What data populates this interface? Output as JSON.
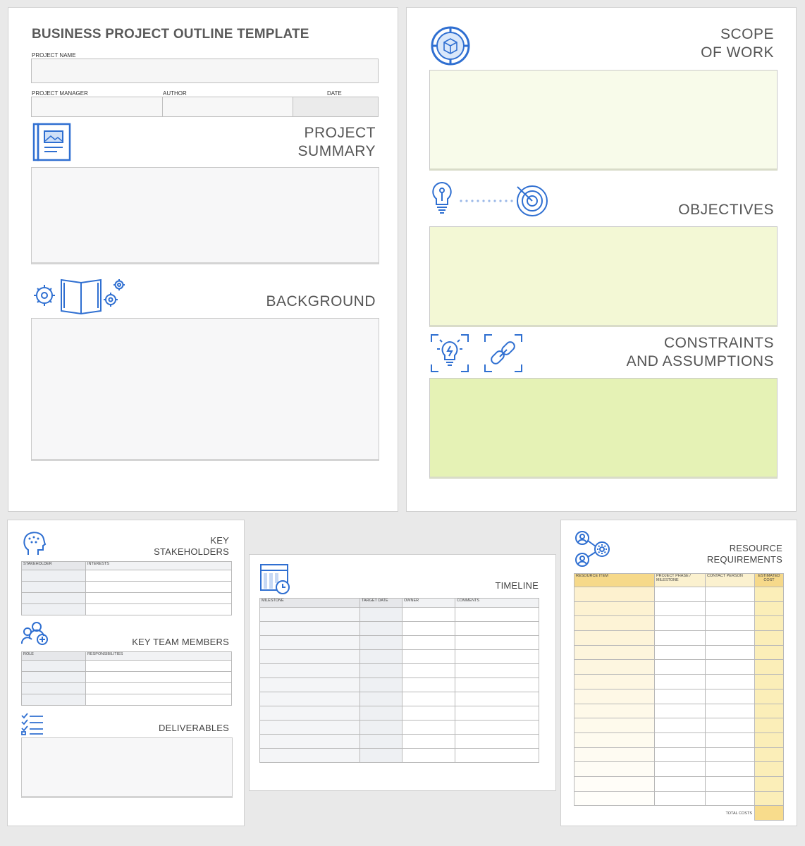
{
  "page1": {
    "title": "BUSINESS PROJECT OUTLINE TEMPLATE",
    "project_name_label": "PROJECT NAME",
    "project_manager_label": "PROJECT MANAGER",
    "author_label": "AUTHOR",
    "date_label": "DATE",
    "project_summary": [
      "PROJECT",
      "SUMMARY"
    ],
    "background": "BACKGROUND"
  },
  "page2": {
    "scope_of_work": [
      "SCOPE",
      "OF WORK"
    ],
    "objectives": "OBJECTIVES",
    "constraints": [
      "CONSTRAINTS",
      "AND ASSUMPTIONS"
    ]
  },
  "page3": {
    "key_stakeholders": [
      "KEY",
      "STAKEHOLDERS"
    ],
    "stakeholders_cols": [
      "STAKEHOLDER",
      "INTERESTS"
    ],
    "key_team_members": "KEY TEAM MEMBERS",
    "team_cols": [
      "ROLE",
      "RESPONSIBILITIES"
    ],
    "deliverables": "DELIVERABLES"
  },
  "page4": {
    "timeline": "TIMELINE",
    "timeline_cols": [
      "MILESTONE",
      "TARGET DATE",
      "OWNER",
      "COMMENTS"
    ]
  },
  "page5": {
    "resource_requirements": [
      "RESOURCE",
      "REQUIREMENTS"
    ],
    "resource_cols": [
      "RESOURCE ITEM",
      "PROJECT PHASE / MILESTONE",
      "CONTACT PERSON",
      "ESTIMATED COST"
    ],
    "total_costs": "TOTAL COSTS"
  },
  "colors": {
    "icon_blue": "#2f6fd1",
    "scope_fill": "#f8fbea",
    "objectives_fill": "#f3f8d5",
    "constraints_fill": "#e5f2b5",
    "resource_header": "#f6d98a",
    "cost_column": "#fbeeb8"
  },
  "icons": [
    "book-icon",
    "gears-book-icon",
    "cube-icon",
    "lightbulb-target-icon",
    "lightbulb-frame-icon",
    "link-frame-icon",
    "head-icon",
    "team-add-icon",
    "checklist-icon",
    "calendar-clock-icon",
    "people-gear-icon"
  ]
}
